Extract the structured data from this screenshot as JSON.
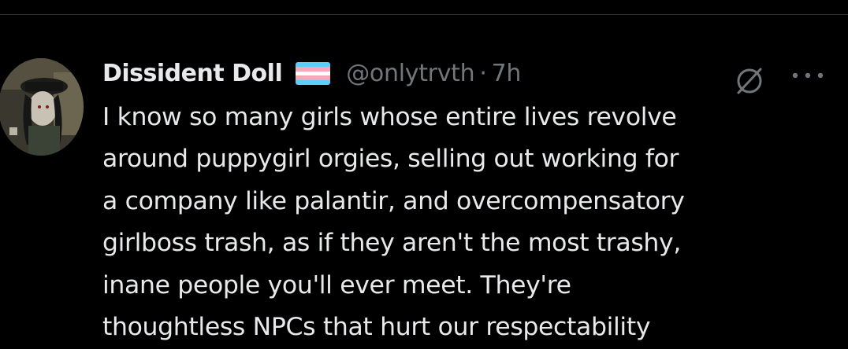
{
  "tweet": {
    "author": {
      "display_name": "Dissident Doll",
      "flag_icon": "transgender-flag-icon",
      "handle": "@onlytrvth",
      "separator": "·",
      "timestamp": "7h"
    },
    "text_lines": [
      "I know so many girls whose entire lives revolve",
      "around puppygirl orgies, selling out working for",
      "a company like palantir, and overcompensatory",
      "girlboss trash, as if they aren't the most trashy,",
      "inane people you'll ever meet. They're",
      "thoughtless NPCs that hurt our respectability"
    ],
    "icons": {
      "avatar": "avatar-icon",
      "status": "slashed-circle-icon",
      "more": "more-options-icon"
    }
  },
  "colors": {
    "background": "#000000",
    "primary_text": "#e7e9ea",
    "secondary_text": "#71767b",
    "divider": "#2f3336",
    "flag_blue": "#5bcefa",
    "flag_pink": "#f5a9b8",
    "flag_white": "#ffffff"
  }
}
